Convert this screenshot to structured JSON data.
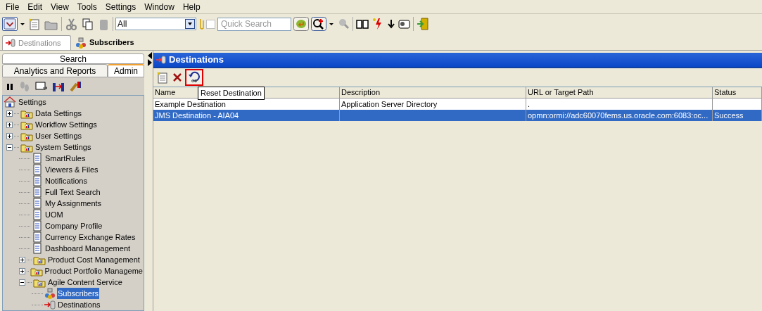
{
  "menu": [
    "File",
    "Edit",
    "View",
    "Tools",
    "Settings",
    "Window",
    "Help"
  ],
  "toolbar": {
    "scope": "All",
    "attachment": {
      "checked": false
    },
    "search": {
      "placeholder": "Quick Search"
    }
  },
  "doc_tabs": [
    {
      "label": "Destinations",
      "selected": true
    },
    {
      "label": "Subscribers",
      "selected": false
    }
  ],
  "left_panel": {
    "search_tab": "Search",
    "tabs": [
      {
        "label": "Analytics and Reports",
        "selected": false
      },
      {
        "label": "Admin",
        "selected": true
      }
    ],
    "tree": [
      {
        "label": "Settings",
        "kind": "home",
        "selected": false,
        "children": [
          {
            "label": "Data Settings",
            "kind": "folder",
            "expanded": false,
            "selected": false
          },
          {
            "label": "Workflow Settings",
            "kind": "folder",
            "expanded": false,
            "selected": false
          },
          {
            "label": "User Settings",
            "kind": "folder",
            "expanded": false,
            "selected": false
          },
          {
            "label": "System Settings",
            "kind": "folder",
            "expanded": true,
            "selected": false,
            "children": [
              {
                "label": "SmartRules",
                "kind": "item",
                "selected": false
              },
              {
                "label": "Viewers & Files",
                "kind": "item",
                "selected": false
              },
              {
                "label": "Notifications",
                "kind": "item",
                "selected": false
              },
              {
                "label": "Full Text Search",
                "kind": "item",
                "selected": false
              },
              {
                "label": "My Assignments",
                "kind": "item",
                "selected": false
              },
              {
                "label": "UOM",
                "kind": "item",
                "selected": false
              },
              {
                "label": "Company Profile",
                "kind": "item",
                "selected": false
              },
              {
                "label": "Currency Exchange Rates",
                "kind": "item",
                "selected": false
              },
              {
                "label": "Dashboard Management",
                "kind": "item",
                "selected": false
              },
              {
                "label": "Product Cost Management",
                "kind": "folder",
                "expanded": false,
                "selected": false
              },
              {
                "label": "Product Portfolio Manageme",
                "kind": "folder",
                "expanded": false,
                "selected": false
              },
              {
                "label": "Agile Content Service",
                "kind": "folder",
                "expanded": true,
                "selected": false,
                "children": [
                  {
                    "label": "Subscribers",
                    "kind": "subscribers",
                    "selected": true
                  },
                  {
                    "label": "Destinations",
                    "kind": "destination",
                    "selected": false
                  }
                ]
              }
            ]
          }
        ]
      }
    ]
  },
  "panel": {
    "title": "Destinations",
    "tooltip": "Reset Destination",
    "table": {
      "columns": [
        "Name",
        "Description",
        "URL or Target Path",
        "Status"
      ],
      "rows": [
        {
          "name": "Example Destination",
          "description": "Application Server Directory",
          "url": ".",
          "selected": false
        },
        {
          "name": "JMS Destination - AIA04",
          "url": "opmn:ormi://adc60070fems.us.oracle.com:6083:oc...",
          "status": "Success",
          "selected": true
        }
      ]
    }
  }
}
